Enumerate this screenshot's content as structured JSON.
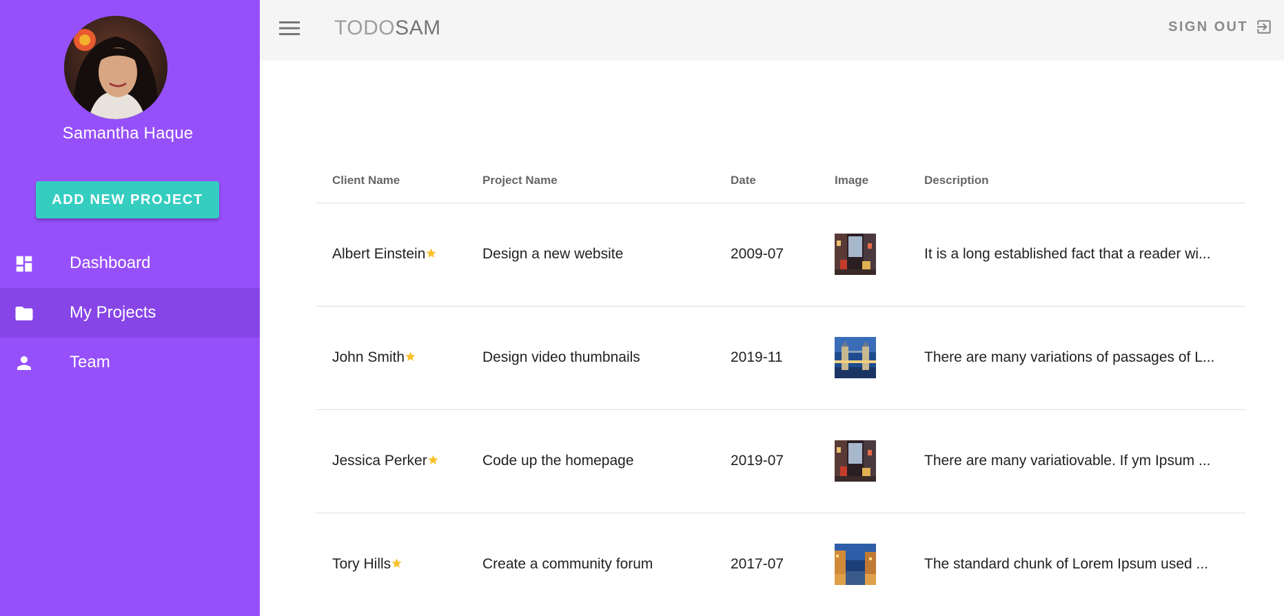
{
  "sidebar": {
    "user_name": "Samantha Haque",
    "add_button_label": "ADD NEW PROJECT",
    "items": [
      {
        "label": "Dashboard",
        "icon": "dashboard-icon"
      },
      {
        "label": "My Projects",
        "icon": "folder-icon",
        "active": true
      },
      {
        "label": "Team",
        "icon": "person-icon"
      }
    ],
    "background_color": "#9650fa",
    "active_item_color": "#8745e8",
    "button_color": "#36cdc1"
  },
  "topbar": {
    "menu_icon": "menu-icon",
    "title_part1": "TODO",
    "title_part2": "SAM",
    "signout_label": "SIGN OUT",
    "signout_icon": "exit-icon"
  },
  "table": {
    "headers": {
      "client": "Client Name",
      "project": "Project Name",
      "date": "Date",
      "image": "Image",
      "description": "Description"
    },
    "rows": [
      {
        "client": "Albert Einstein",
        "project": "Design a new website",
        "date": "2009-07",
        "image": "city-street-thumbnail",
        "description": "It is a long established fact that a reader wi..."
      },
      {
        "client": "John Smith",
        "project": "Design video thumbnails",
        "date": "2019-11",
        "image": "tower-bridge-thumbnail",
        "description": "There are many variations of passages of L..."
      },
      {
        "client": "Jessica Perker",
        "project": "Code up the homepage",
        "date": "2019-07",
        "image": "city-street-thumbnail",
        "description": "There are many variatiovable. If ym Ipsum ..."
      },
      {
        "client": "Tory Hills",
        "project": "Create a community forum",
        "date": "2017-07",
        "image": "canal-city-thumbnail",
        "description": "The standard chunk of Lorem Ipsum used ..."
      }
    ],
    "star_color": "#fbc02d"
  }
}
